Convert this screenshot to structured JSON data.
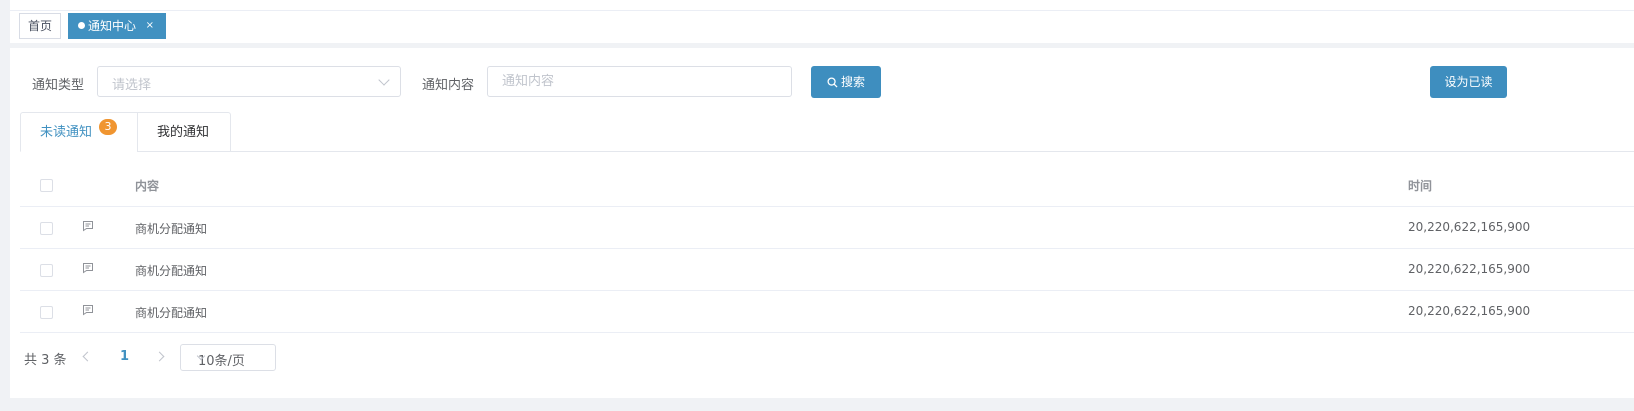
{
  "tags_bar": {
    "home_label": "首页",
    "active_label": "通知中心",
    "close_glyph": "×"
  },
  "filters": {
    "type_label": "通知类型",
    "type_placeholder": "请选择",
    "content_label": "通知内容",
    "content_placeholder": "通知内容",
    "search_label": "搜索",
    "mark_read_label": "设为已读"
  },
  "tabs": [
    {
      "label": "未读通知",
      "badge": "3",
      "active": true
    },
    {
      "label": "我的通知",
      "active": false
    }
  ],
  "table": {
    "columns": [
      "内容",
      "时间"
    ],
    "rows": [
      {
        "icon": "message-icon",
        "content": "商机分配通知",
        "time": "20,220,622,165,900"
      },
      {
        "icon": "message-icon",
        "content": "商机分配通知",
        "time": "20,220,622,165,900"
      },
      {
        "icon": "message-icon",
        "content": "商机分配通知",
        "time": "20,220,622,165,900"
      }
    ]
  },
  "pagination": {
    "total_text": "共 3 条",
    "current_page": "1",
    "page_size": "10条/页"
  },
  "colors": {
    "accent": "#4191c1",
    "badge": "#f09530",
    "button": "#3e8ebf"
  }
}
